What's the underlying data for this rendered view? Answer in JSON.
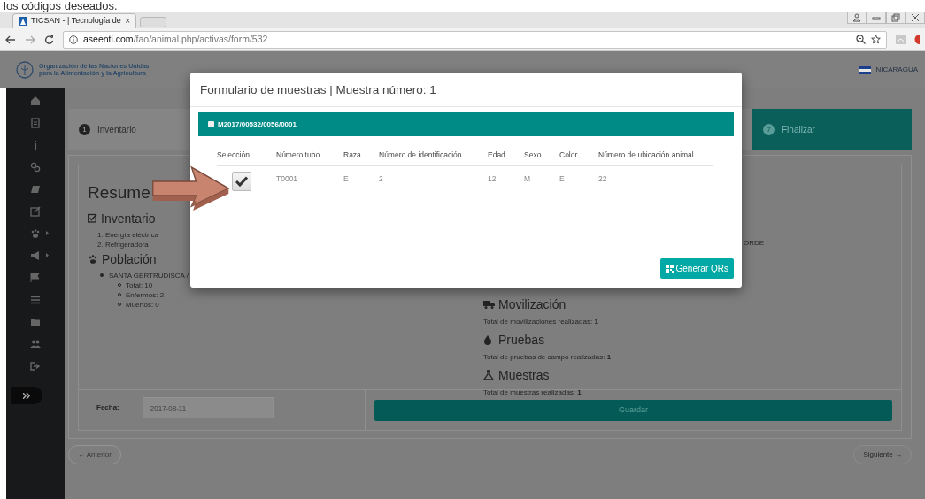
{
  "caption": "los códigos deseados.",
  "browser": {
    "tab_title": "TICSAN - | Tecnología de",
    "tab_close": "×",
    "url_host": "aseenti.com",
    "url_path": "/fao/animal.php/activas/form/532"
  },
  "header": {
    "org_line_1": "Organización de las Naciones Unidas",
    "org_line_2": "para la Alimentación y la Agricultura",
    "country": "NICARAGUA"
  },
  "sidebar": {
    "items": [
      {
        "kind": "home",
        "expandable": false
      },
      {
        "kind": "file",
        "expandable": false
      },
      {
        "kind": "info",
        "expandable": false
      },
      {
        "kind": "link",
        "expandable": false
      },
      {
        "kind": "book",
        "expandable": false
      },
      {
        "kind": "edit",
        "expandable": false
      },
      {
        "kind": "paw",
        "expandable": true
      },
      {
        "kind": "bullhorn",
        "expandable": true
      },
      {
        "kind": "flag",
        "expandable": false
      },
      {
        "kind": "list",
        "expandable": false
      },
      {
        "kind": "folder",
        "expandable": false
      },
      {
        "kind": "users",
        "expandable": false
      },
      {
        "kind": "signout",
        "expandable": false
      }
    ]
  },
  "steps": [
    {
      "number": "1",
      "label": "Inventario",
      "selected": false
    },
    {
      "number": "7",
      "label": "Finalizar",
      "selected": true
    }
  ],
  "summary": {
    "title": "Resume",
    "inventario": {
      "title": "Inventario",
      "items": [
        "1. Energía eléctrica",
        "2. Refrigeradora"
      ]
    },
    "poblacion": {
      "title": "Población",
      "groups": [
        {
          "name": "SANTA GERTRUDISCA /",
          "stats": [
            "Total: 10",
            "Enfermos: 2",
            "Muertos: 0"
          ]
        }
      ]
    },
    "right_fragment": "ORDE",
    "sections": [
      {
        "kind": "movilizacion",
        "title": "Movilización",
        "text": "Total de movilizaciones realizadas: **1**"
      },
      {
        "kind": "pruebas",
        "title": "Pruebas",
        "text": "Total de pruebas de campo realizadas: **1**"
      },
      {
        "kind": "muestras",
        "title": "Muestras",
        "text": "Total de muestras realizadas: **1**"
      }
    ]
  },
  "form": {
    "date_label": "Fecha:",
    "date_value": "2017-08-11",
    "date_disabled": true,
    "save": "Guardar"
  },
  "pager": {
    "previous": "← Anterior",
    "next": "Siguiente →",
    "next_disabled": true
  },
  "modal": {
    "title": "Formulario de muestras | Muestra número: 1",
    "group": {
      "code": "M2017/00532/0056/0001",
      "checked": false
    },
    "selection_column": "Selección",
    "columns": [
      "Número tubo",
      "Raza",
      "Número de identificación",
      "Edad",
      "Sexo",
      "Color",
      "Número de ubicación animal"
    ],
    "rows": [
      {
        "checked": true,
        "cells": [
          "T0001",
          "E",
          "2",
          "12",
          "M",
          "E",
          "22"
        ]
      }
    ],
    "button": "Generar QRs"
  }
}
